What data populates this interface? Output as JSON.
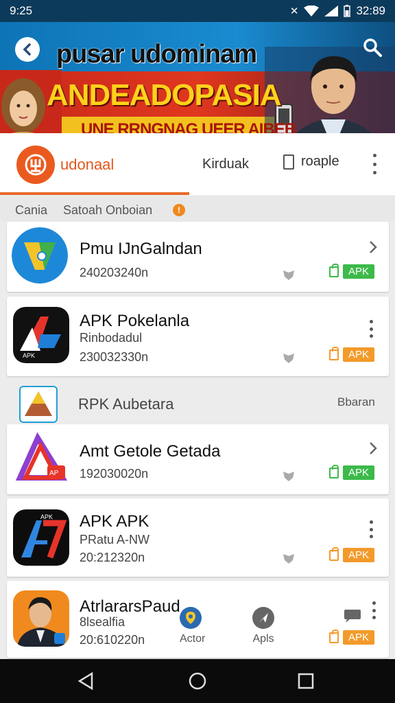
{
  "status_bar": {
    "time": "9:25",
    "clock_right": "32:89"
  },
  "banner": {
    "line1": "pusar udominam",
    "line2": "ANDEADOPASIA",
    "line3": "UNE RRNGNAG UEER AIBEB"
  },
  "tabs": {
    "brand_label": "udonaal",
    "tab2": "Kirduak",
    "tab3": "roaple"
  },
  "section": {
    "left": "Cania",
    "title": "Satoah Onboian",
    "badge": "!"
  },
  "apps": [
    {
      "name": "Pmu IJnGalndan",
      "sub": "",
      "meta": "240203240n",
      "apk": "APK",
      "action": "chevron",
      "apk_color": "#3cba4a"
    },
    {
      "name": "APK Pokelanla",
      "sub": "Rinbodadul",
      "meta": "230032330n",
      "apk": "APK",
      "action": "kebab",
      "apk_color": "#f39a2a"
    },
    {
      "name": "Amt Getole Getada",
      "sub": "",
      "meta": "192030020n",
      "apk": "APK",
      "action": "chevron",
      "apk_color": "#3cba4a"
    },
    {
      "name": "APK APK",
      "sub": "PRatu A-NW",
      "meta": "20:212320n",
      "apk": "APK",
      "action": "kebab",
      "apk_color": "#f39a2a"
    },
    {
      "name": "AtrlararsPaud",
      "sub": "8lsealfia",
      "meta": "20:610220n",
      "apk": "APK",
      "action": "kebab",
      "apk_color": "#f39a2a"
    }
  ],
  "subheader": {
    "title": "RPK Aubetara",
    "right": "Bbaran"
  },
  "mini_nav": {
    "item1": "Actor",
    "item2": "Apls"
  },
  "colors": {
    "accent": "#e76a2a",
    "green": "#3cba4a",
    "orange": "#f39a2a",
    "status_bar": "#0c3a5a"
  }
}
